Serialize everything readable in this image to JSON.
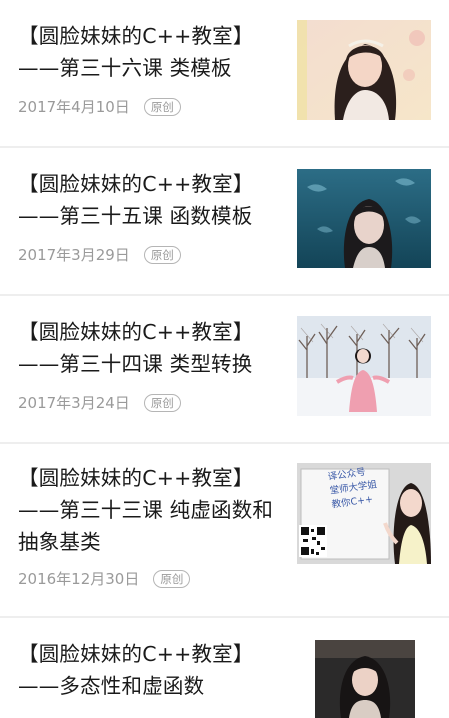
{
  "articles": [
    {
      "title": "【圆脸妹妹的C++教室】——第三十六课 类模板",
      "date": "2017年4月10日",
      "badge": "原创",
      "thumb_icon": "girl-portrait-pink-background"
    },
    {
      "title": "【圆脸妹妹的C++教室】——第三十五课 函数模板",
      "date": "2017年3月29日",
      "badge": "原创",
      "thumb_icon": "girl-portrait-aquarium"
    },
    {
      "title": "【圆脸妹妹的C++教室】——第三十四课 类型转换",
      "date": "2017年3月24日",
      "badge": "原创",
      "thumb_icon": "girl-in-snow-trees"
    },
    {
      "title": "【圆脸妹妹的C++教室】——第三十三课 纯虚函数和抽象基类",
      "date": "2016年12月30日",
      "badge": "原创",
      "thumb_icon": "girl-with-whiteboard-qr",
      "whiteboard_lines": [
        "译公众号",
        "堂师大学姐",
        "教你C++"
      ]
    },
    {
      "title": "【圆脸妹妹的C++教室】——多态性和虚函数",
      "date": "",
      "badge": "",
      "thumb_icon": "girl-portrait-dark-background"
    }
  ],
  "colors": {
    "title": "#1a1a1a",
    "meta": "#9a9a9a",
    "separator": "#eeeeee"
  }
}
